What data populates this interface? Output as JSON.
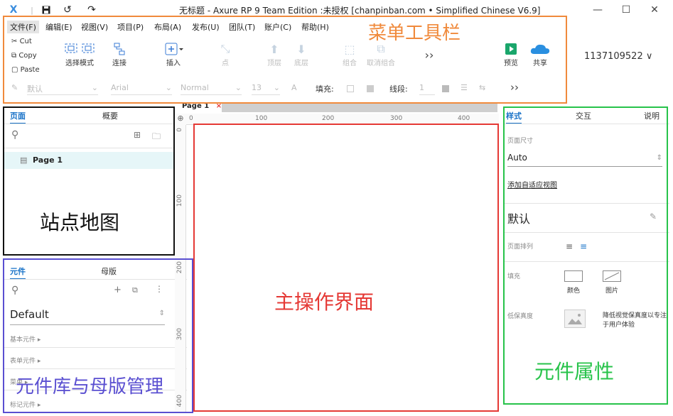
{
  "window": {
    "title": "无标题 - Axure RP 9 Team Edition :未授权    [chanpinban.com • Simplified Chinese V6.9]"
  },
  "menu": {
    "items": [
      "文件(F)",
      "编辑(E)",
      "视图(V)",
      "项目(P)",
      "布局(A)",
      "发布(U)",
      "团队(T)",
      "账户(C)",
      "帮助(H)"
    ]
  },
  "clipboard": {
    "cut": "Cut",
    "copy": "Copy",
    "paste": "Paste"
  },
  "toolbar": {
    "select_mode": "选择模式",
    "connect": "连接",
    "insert": "插入",
    "point": "点",
    "to_top": "顶层",
    "to_bottom": "底层",
    "group": "组合",
    "ungroup": "取消组合",
    "more": "››",
    "preview": "预览",
    "share": "共享",
    "account": "1137109522 ∨"
  },
  "format_bar": {
    "style": "默认",
    "font": "Arial",
    "weight": "Normal",
    "size": "13",
    "fill_label": "填充:",
    "line_label": "线段:",
    "line_value": "1",
    "more": "››"
  },
  "pages_panel": {
    "tab_pages": "页面",
    "tab_outline": "概要",
    "page_item": "Page 1"
  },
  "library_panel": {
    "tab_library": "元件",
    "tab_masters": "母版",
    "library_select": "Default",
    "sections": [
      "基本元件 ▸",
      "表单元件 ▸",
      "菜单 ▸",
      "标记元件 ▸"
    ]
  },
  "canvas": {
    "tab": "Page 1",
    "ruler_h": [
      "0",
      "100",
      "200",
      "300",
      "400"
    ],
    "ruler_v": [
      "0",
      "100",
      "200",
      "300",
      "400"
    ]
  },
  "props_panel": {
    "tab_style": "样式",
    "tab_interact": "交互",
    "tab_notes": "说明",
    "page_size_label": "页面尺寸",
    "page_size_value": "Auto",
    "adaptive_link": "添加自适应视图",
    "style_name": "默认",
    "arrange_label": "页面排列",
    "fill_label": "填充",
    "fill_color": "颜色",
    "fill_image": "图片",
    "fidelity_label": "低保真度",
    "fidelity_desc_1": "降低视觉保真度以专注",
    "fidelity_desc_2": "于用户体验"
  },
  "annotations": {
    "menu_toolbar": "菜单工具栏",
    "sitemap": "站点地图",
    "library_masters": "元件库与母版管理",
    "main_area": "主操作界面",
    "props": "元件属性"
  },
  "colors": {
    "orange": "#f08a3c",
    "black": "#111111",
    "purple": "#5a4fd1",
    "red": "#e53935",
    "green": "#27c34a",
    "accent": "#1a73c8"
  }
}
